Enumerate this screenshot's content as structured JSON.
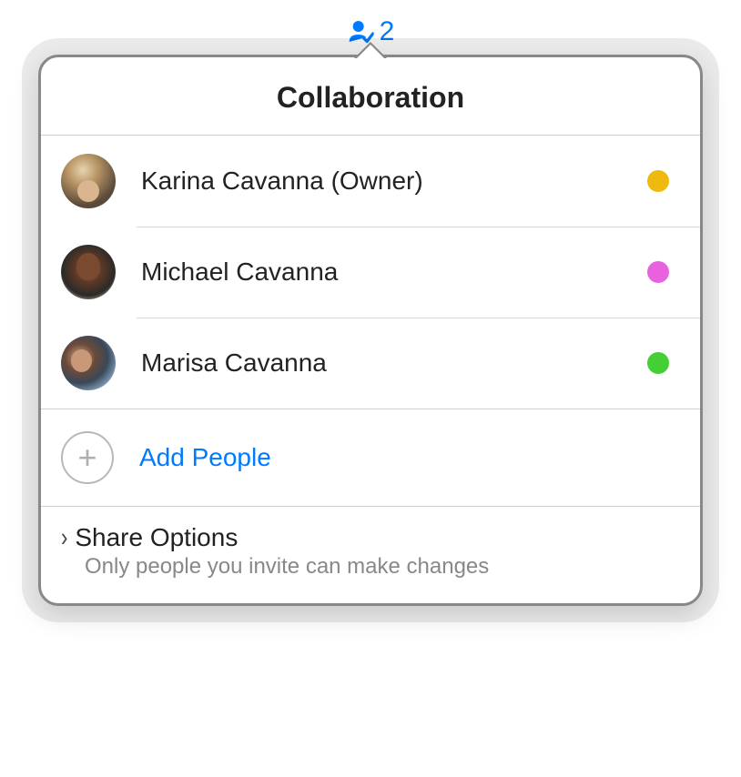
{
  "badge": {
    "count": "2"
  },
  "header": {
    "title": "Collaboration"
  },
  "people": [
    {
      "name": "Karina Cavanna (Owner)",
      "statusColor": "#f0b90d"
    },
    {
      "name": "Michael Cavanna",
      "statusColor": "#e862e0"
    },
    {
      "name": "Marisa Cavanna",
      "statusColor": "#44d035"
    }
  ],
  "addPeople": {
    "label": "Add People"
  },
  "shareOptions": {
    "title": "Share Options",
    "subtitle": "Only people you invite can make changes"
  }
}
